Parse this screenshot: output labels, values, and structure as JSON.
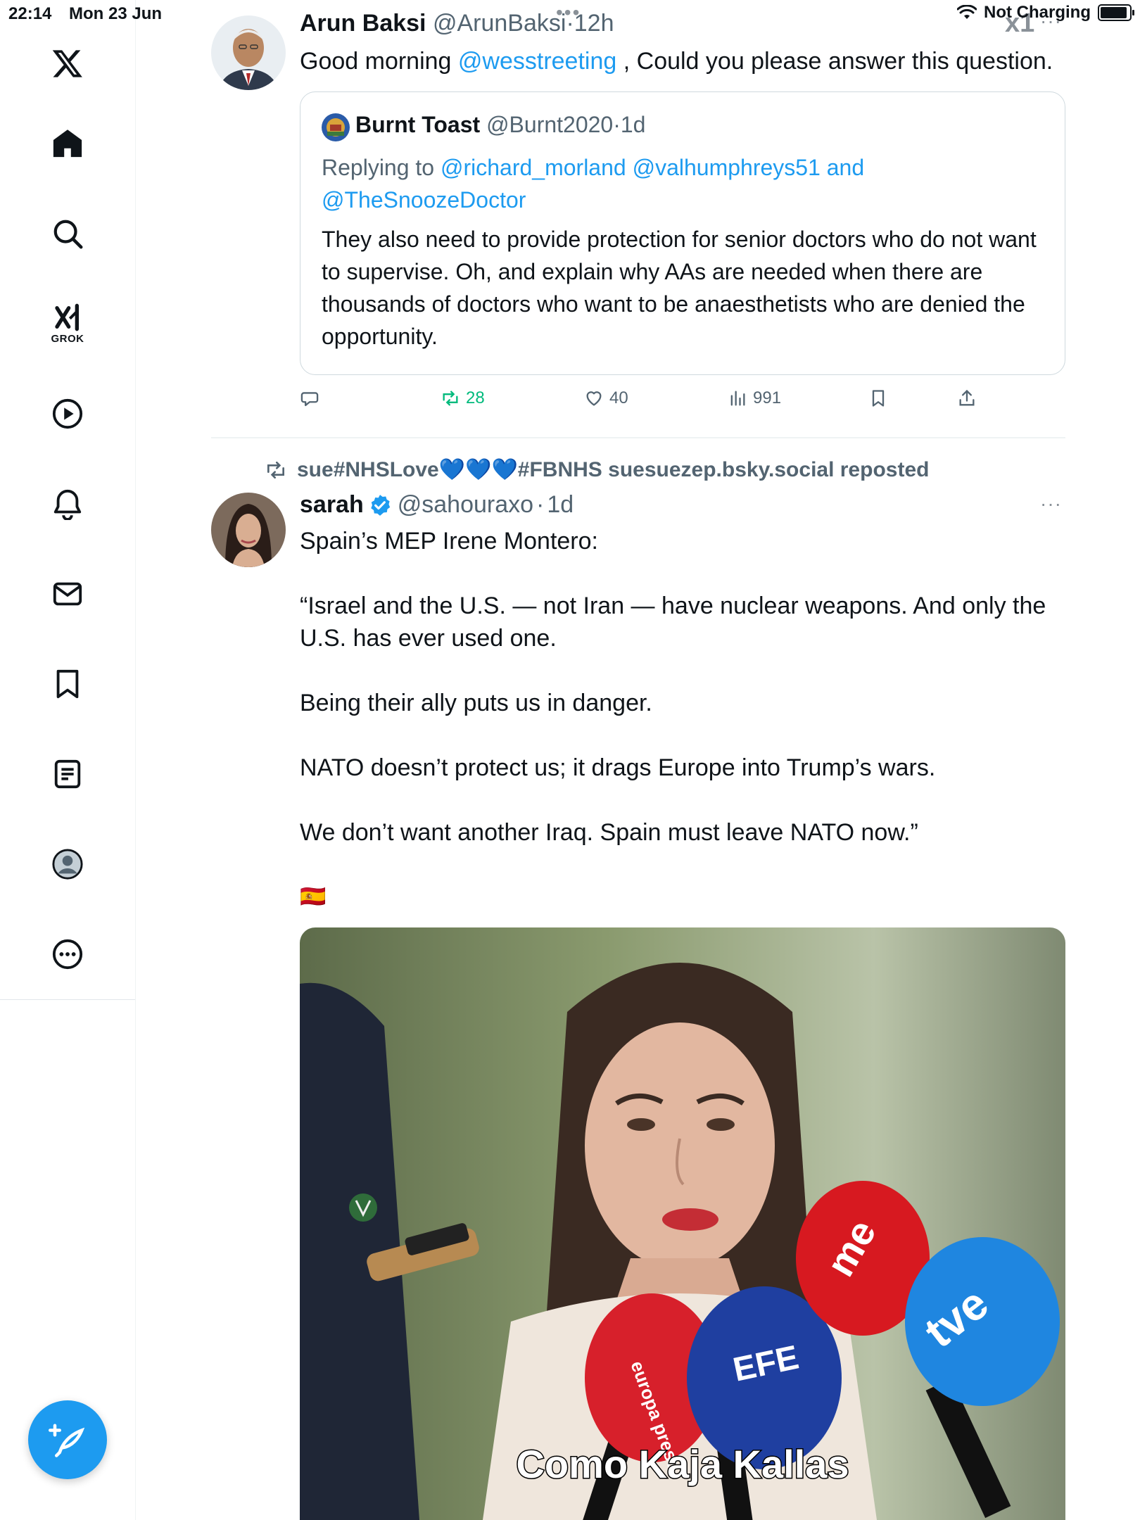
{
  "status_bar": {
    "time": "22:14",
    "date": "Mon 23 Jun",
    "dots": "•••",
    "charging": "Not Charging"
  },
  "sidebar": {
    "items": [
      {
        "label": "Home"
      },
      {
        "label": "Search"
      },
      {
        "label": "GROK"
      },
      {
        "label": "Video"
      },
      {
        "label": "Notifications"
      },
      {
        "label": "Messages"
      },
      {
        "label": "Bookmarks"
      },
      {
        "label": "Lists"
      },
      {
        "label": "Profile"
      },
      {
        "label": "More"
      }
    ]
  },
  "tweet1": {
    "name": "Arun Baksi",
    "handle": "@ArunBaksi",
    "dot": "·",
    "time": "12h",
    "text_before": "Good morning ",
    "mention": "@wesstreeting",
    "text_after": " , Could you please answer this question.",
    "quote": {
      "name": "Burnt Toast",
      "handle": "@Burnt2020",
      "dot": "·",
      "time": "1d",
      "replying_prefix": "Replying to ",
      "replying_to": "@richard_morland @valhumphreys51 and",
      "replying_to_2": "@TheSnoozeDoctor",
      "text": "They also need to provide protection for senior doctors who do not want to supervise. Oh, and explain why AAs are needed when there are thousands of doctors who want to be anaesthetists who are denied the opportunity."
    },
    "stats": {
      "reposts": "28",
      "likes": "40",
      "views": "991"
    }
  },
  "tweet2": {
    "repost_line": "sue#NHSLove💙💙💙#FBNHS suesuezep.bsky.social reposted",
    "name": "sarah",
    "handle": "@sahouraxo",
    "dot": "·",
    "time": "1d",
    "paragraphs": [
      "Spain’s MEP Irene Montero:",
      "“Israel and the U.S. — not Iran — have nuclear weapons. And only the U.S. has ever used one.",
      "Being their ally puts us in danger.",
      "NATO doesn’t protect us; it drags Europe into Trump’s wars.",
      "We don’t want another Iraq. Spain must leave NATO now.”"
    ],
    "flag": "🇪🇸",
    "media": {
      "caption": "Como Kaja Kallas",
      "mic_labels": {
        "europa": "europa press",
        "efe": "EFE",
        "tve": "tve",
        "me": "me"
      }
    }
  },
  "colors": {
    "accent": "#1d9bf0",
    "repost_green": "#00ba7c",
    "muted": "#536471"
  }
}
